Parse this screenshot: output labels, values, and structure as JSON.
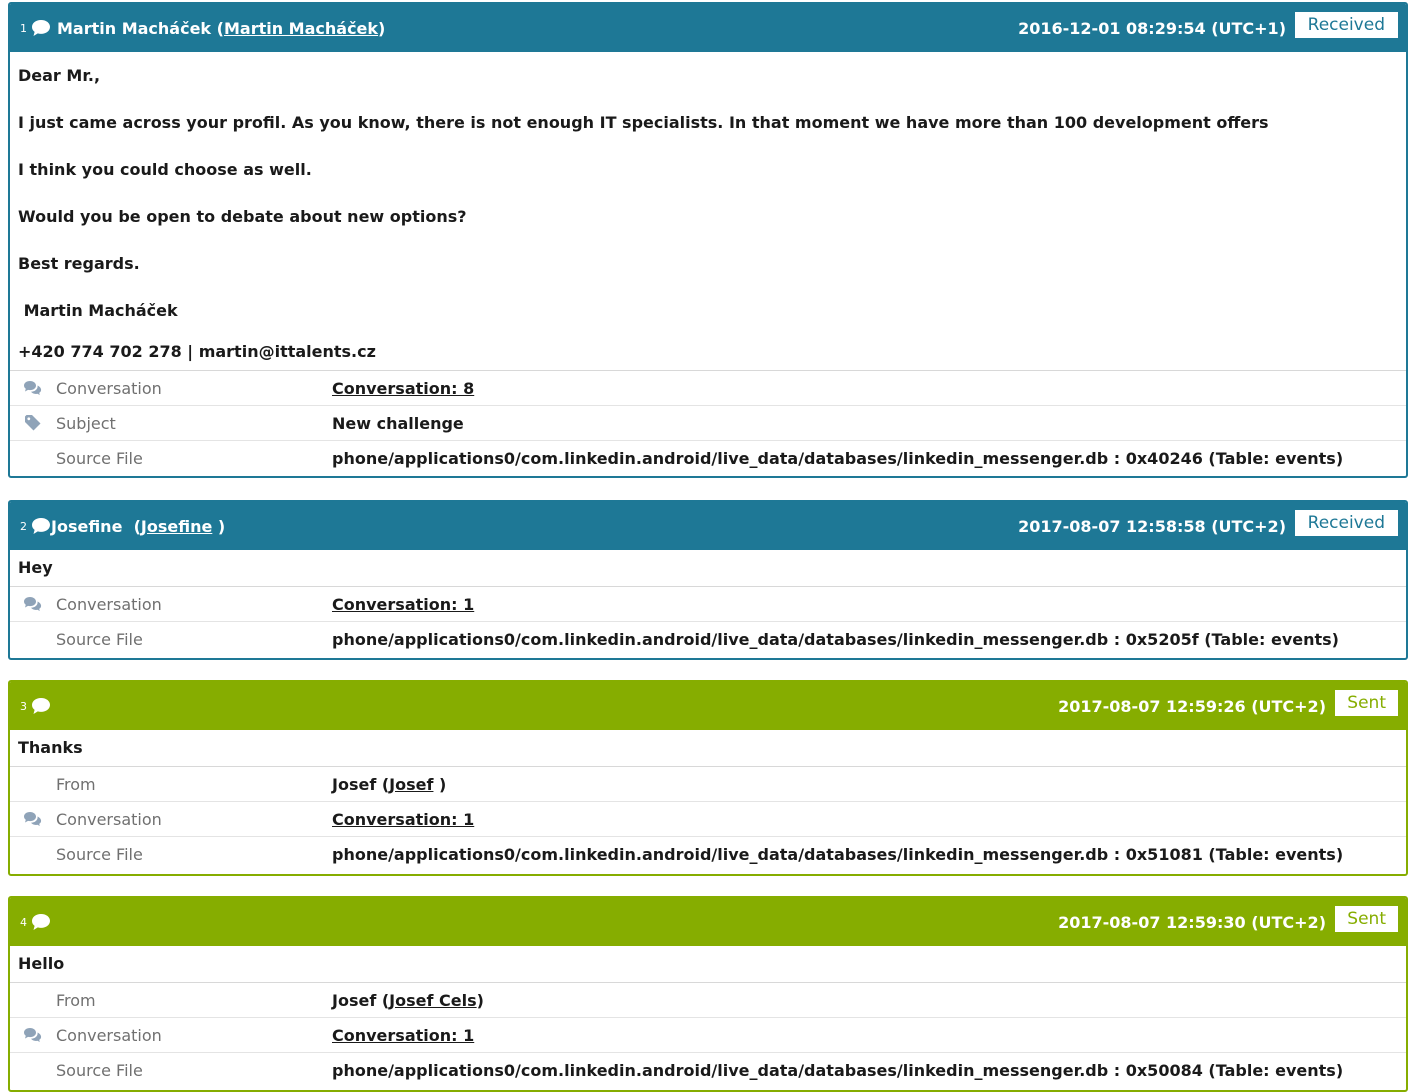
{
  "messages": [
    {
      "num": "1",
      "type": "received",
      "sender_name": "Martin Macháček",
      "sender_link": "Martin Macháček",
      "timestamp": "2016-12-01 08:29:54 (UTC+1)",
      "badge": "Received",
      "body": [
        "Dear Mr.,",
        "I just came across your profil. As you know, there is not enough IT specialists. In that moment we have more than 100 development offers",
        "I think you could choose as well.",
        "Would you be open to debate about new options?",
        "Best regards.",
        " Martin Macháček",
        "+420 774 702 278 | martin@ittalents.cz"
      ],
      "conversation_label": "Conversation",
      "conversation_value": "Conversation: 8",
      "subject_label": "Subject",
      "subject_value": "New challenge",
      "source_label": "Source File",
      "source_value": "phone/applications0/com.linkedin.android/live_data/databases/linkedin_messenger.db : 0x40246 (Table: events)"
    },
    {
      "num": "2",
      "type": "received",
      "sender_name": "Josefine ",
      "sender_link": "Josefine",
      "timestamp": "2017-08-07 12:58:58 (UTC+2)",
      "badge": "Received",
      "body": [
        "Hey"
      ],
      "conversation_label": "Conversation",
      "conversation_value": "Conversation: 1",
      "source_label": "Source File",
      "source_value": "phone/applications0/com.linkedin.android/live_data/databases/linkedin_messenger.db : 0x5205f (Table: events)"
    },
    {
      "num": "3",
      "type": "sent",
      "timestamp": "2017-08-07 12:59:26 (UTC+2)",
      "badge": "Sent",
      "body": [
        "Thanks"
      ],
      "from_label": "From",
      "from_name": "Josef",
      "from_link": "Josef",
      "conversation_label": "Conversation",
      "conversation_value": "Conversation: 1",
      "source_label": "Source File",
      "source_value": "phone/applications0/com.linkedin.android/live_data/databases/linkedin_messenger.db : 0x51081 (Table: events)"
    },
    {
      "num": "4",
      "type": "sent",
      "timestamp": "2017-08-07 12:59:30 (UTC+2)",
      "badge": "Sent",
      "body": [
        "Hello"
      ],
      "from_label": "From",
      "from_name": "Josef",
      "from_link": "Josef Cels",
      "conversation_label": "Conversation",
      "conversation_value": "Conversation: 1",
      "source_label": "Source File",
      "source_value": "phone/applications0/com.linkedin.android/live_data/databases/linkedin_messenger.db : 0x50084 (Table: events)"
    }
  ],
  "colors": {
    "received": "#1e7896",
    "sent": "#86ad00"
  },
  "icons": {
    "message": "speech-bubble-icon",
    "conversation": "comments-icon",
    "subject": "tag-icon"
  }
}
